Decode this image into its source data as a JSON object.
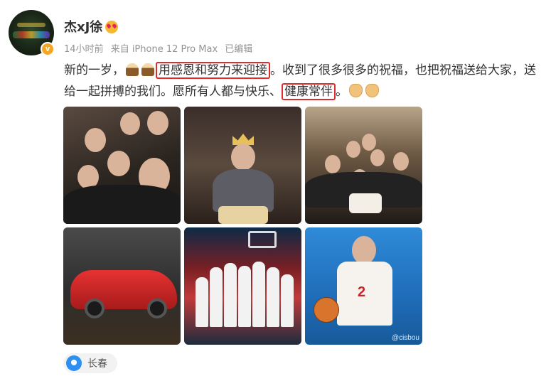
{
  "post": {
    "username": "杰xJ徐",
    "time": "14小时前",
    "source": "来自 iPhone 12 Pro Max",
    "edited": "已编辑",
    "text": {
      "p1": "新的一岁，",
      "hl1": "用感恩和努力来迎接",
      "p2": "。收到了很多很多的祝福，也把祝福送给大家，送给一起拼搏的我们。愿所有人都与快乐、",
      "hl2": "健康常伴",
      "p3": "。"
    }
  },
  "photos": [
    {
      "name": "team-selfie"
    },
    {
      "name": "birthday-wish"
    },
    {
      "name": "team-birthday-cake"
    },
    {
      "name": "red-lego-car"
    },
    {
      "name": "team-huddle"
    },
    {
      "name": "player-dribbling",
      "number": "2",
      "watermark": "@cisbou"
    }
  ],
  "location": "长春",
  "colors": {
    "highlight": "#e12a2a",
    "verified": "#f5a623",
    "pin": "#2d8ff0"
  },
  "icons": [
    "heart-eyes-emoji-icon",
    "cake-emoji-icon",
    "fist-bump-emoji-icon",
    "verified-badge-icon",
    "location-pin-icon"
  ]
}
